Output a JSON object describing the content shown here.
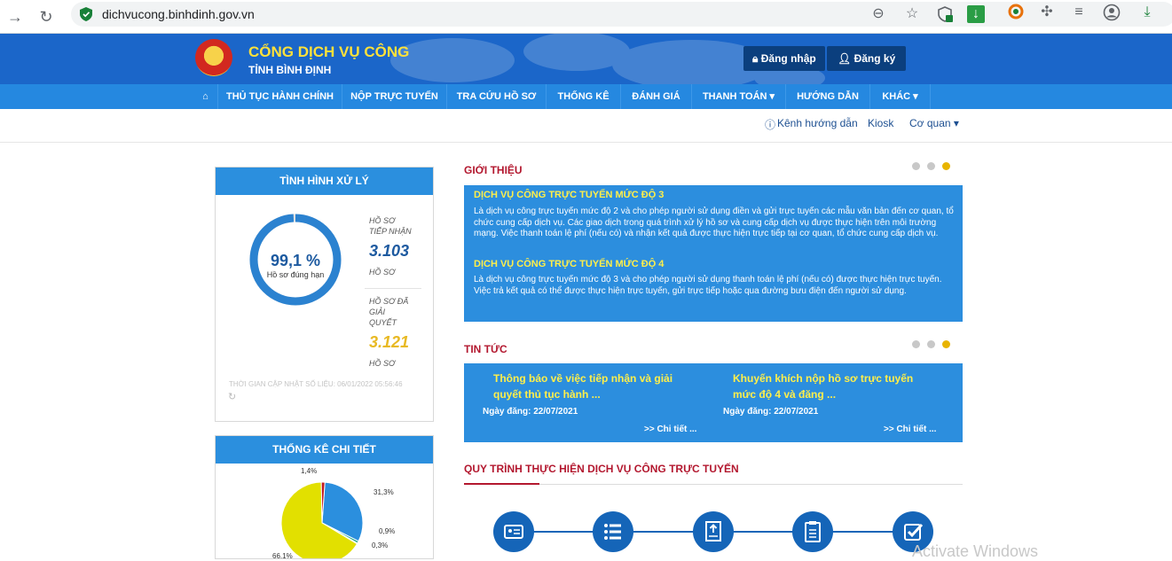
{
  "browser": {
    "url": "dichvucong.binhdinh.gov.vn",
    "ext_badge": "2"
  },
  "header": {
    "title": "CỔNG DỊCH VỤ CÔNG",
    "subtitle": "TỈNH BÌNH ĐỊNH",
    "login_label": "Đăng nhập",
    "register_label": "Đăng ký"
  },
  "nav": {
    "items": [
      "THỦ TỤC HÀNH CHÍNH",
      "NỘP TRỰC TUYẾN",
      "TRA CỨU HỒ SƠ",
      "THỐNG KÊ",
      "ĐÁNH GIÁ",
      "THANH TOÁN ▾",
      "HƯỚNG DẪN",
      "KHÁC ▾"
    ]
  },
  "subnav": {
    "guide": "Kênh hướng dẫn",
    "kiosk": "Kiosk",
    "agency": "Cơ quan ▾"
  },
  "processing": {
    "heading": "TÌNH HÌNH XỬ LÝ",
    "percent": "99,1 %",
    "percent_value": 99.1,
    "percent_caption": "Hồ sơ đúng hạn",
    "received_label_1": "HỒ SƠ",
    "received_label_2": "TIẾP NHẬN",
    "received_value": "3.103",
    "received_unit": "HỒ SƠ",
    "resolved_label_1": "HỒ SƠ ĐÃ",
    "resolved_label_2": "GIẢI",
    "resolved_label_3": "QUYẾT",
    "resolved_value": "3.121",
    "resolved_unit": "HỒ SƠ",
    "updated": "THỜI GIAN CẬP NHẬT SỐ LIỆU: 06/01/2022 05:56:46"
  },
  "stats": {
    "heading": "THỐNG KÊ CHI TIẾT"
  },
  "chart_data": {
    "type": "pie",
    "values": [
      66.1,
      31.3,
      0.9,
      0.3,
      1.4
    ],
    "labels": [
      "66,1%",
      "31,3%",
      "0,9%",
      "0,3%",
      "1,4%"
    ],
    "colors": [
      "#e2e000",
      "#2b8fde",
      "#1aa38a",
      "#d94a1a",
      "#c0191f"
    ]
  },
  "intro": {
    "heading": "GIỚI THIỆU",
    "item1_title": "DỊCH VỤ CÔNG TRỰC TUYẾN MỨC ĐỘ 3",
    "item1_body": "Là dịch vụ công trực tuyến mức độ 2 và cho phép người sử dụng điền và gửi trực tuyến các mẫu văn bản đến cơ quan, tổ chức cung cấp dịch vụ. Các giao dịch trong quá trình xử lý hồ sơ và cung cấp dịch vụ được thực hiện trên môi trường mạng. Việc thanh toán lệ phí (nếu có) và nhận kết quả được thực hiện trực tiếp tại cơ quan, tổ chức cung cấp dịch vụ.",
    "item2_title": "DỊCH VỤ CÔNG TRỰC TUYẾN MỨC ĐỘ 4",
    "item2_body": "Là dịch vụ công trực tuyến mức độ 3 và cho phép người sử dụng thanh toán lệ phí (nếu có) được thực hiện trực tuyến. Việc trả kết quả có thể được thực hiện trực tuyến, gửi trực tiếp hoặc qua đường bưu điện đến người sử dụng."
  },
  "news": {
    "heading": "TIN TỨC",
    "item1_title": "Thông báo về việc tiếp nhận và giải quyết thủ tục hành ...",
    "item1_date": "Ngày đăng: 22/07/2021",
    "item1_more": ">> Chi tiết ...",
    "item2_title": "Khuyến khích nộp hồ sơ trực tuyến mức độ 4 và đăng ...",
    "item2_date": "Ngày đăng: 22/07/2021",
    "item2_more": ">> Chi tiết ..."
  },
  "process": {
    "heading": "QUY TRÌNH THỰC HIỆN DỊCH VỤ CÔNG TRỰC TUYẾN"
  },
  "watermark": "Activate Windows"
}
